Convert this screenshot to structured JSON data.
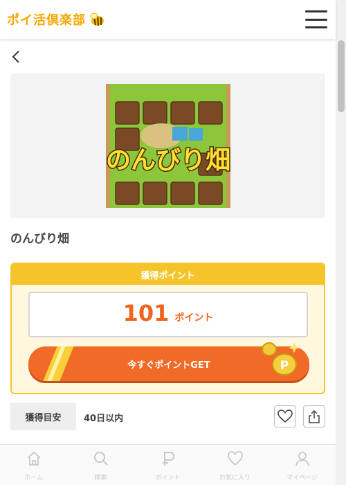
{
  "header": {
    "logo_text": "ポイ活倶楽部",
    "logo_icon": "bee-icon",
    "menu_icon": "hamburger-menu-icon"
  },
  "app": {
    "title": "のんびり畑",
    "thumbnail_icon": "nonbiri-hatake-app-icon",
    "thumbnail_text": "のんびり畑"
  },
  "points_panel": {
    "heading": "獲得ポイント",
    "points": "101",
    "unit": "ポイント",
    "cta_label": "今すぐポイントGET"
  },
  "estimate": {
    "label": "獲得目安",
    "value": "40日以内"
  },
  "actions": {
    "favorite_icon": "heart-icon",
    "share_icon": "share-icon"
  },
  "bottom_nav": {
    "items": [
      {
        "label": "ホーム",
        "icon": "home-icon"
      },
      {
        "label": "検索",
        "icon": "search-icon"
      },
      {
        "label": "ポイント",
        "icon": "point-icon"
      },
      {
        "label": "お気に入り",
        "icon": "heart-icon"
      },
      {
        "label": "マイページ",
        "icon": "user-icon"
      }
    ]
  },
  "colors": {
    "accent": "#f5a800",
    "panel_yellow": "#f4c42a",
    "cta_orange": "#f06a28",
    "points_orange": "#f0641e"
  }
}
